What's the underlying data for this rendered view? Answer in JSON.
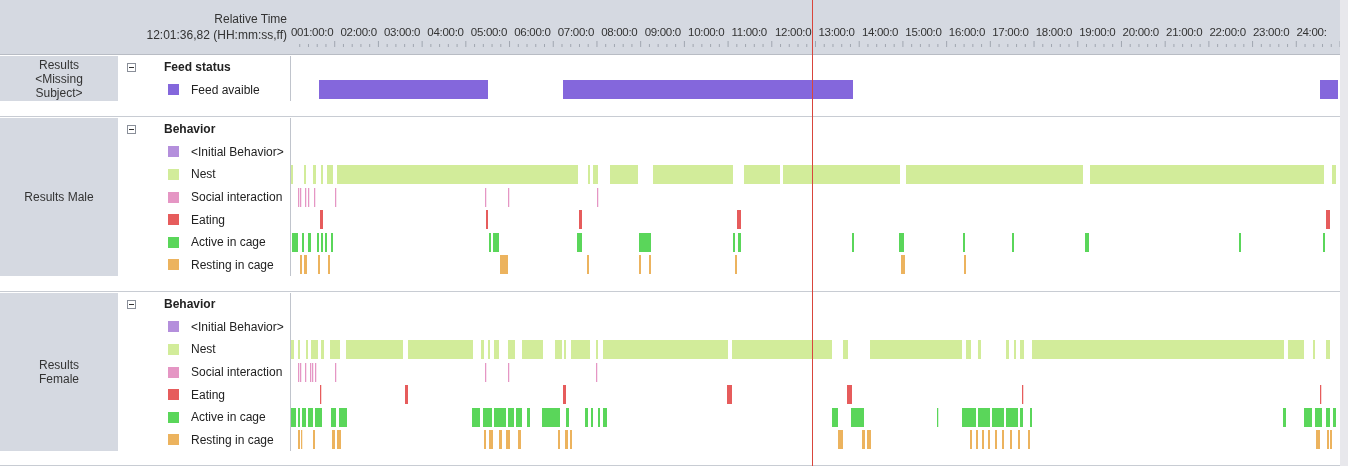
{
  "header": {
    "title": "Relative Time",
    "start": "12:01:36,82 (HH:mm:ss,ff)",
    "ticks": [
      "0",
      "01:00:0",
      "02:00:0",
      "03:00:0",
      "04:00:0",
      "05:00:0",
      "06:00:0",
      "07:00:0",
      "08:00:0",
      "09:00:0",
      "10:00:0",
      "11:00:0",
      "12:00:0",
      "13:00:0",
      "14:00:0",
      "15:00:0",
      "16:00:0",
      "17:00:0",
      "18:00:0",
      "19:00:0",
      "20:00:0",
      "21:00:0",
      "22:00:0",
      "23:00:0",
      "24:00:"
    ]
  },
  "sections": [
    {
      "subject": "Results <Missing Subject>",
      "group": {
        "title": "Feed status",
        "expanded": true,
        "items": [
          {
            "label": "Feed avaible",
            "color": "#8467dc"
          }
        ]
      }
    },
    {
      "subject": "Results Male",
      "group": {
        "title": "Behavior",
        "expanded": true,
        "items": [
          {
            "label": "<Initial Behavior>",
            "color": "#b48fdc"
          },
          {
            "label": "Nest",
            "color": "#d2ec9a"
          },
          {
            "label": "Social interaction",
            "color": "#e596c4"
          },
          {
            "label": "Eating",
            "color": "#e65c5c"
          },
          {
            "label": "Active in cage",
            "color": "#5ad65a"
          },
          {
            "label": "Resting in cage",
            "color": "#ecb35e"
          }
        ]
      }
    },
    {
      "subject": "Results Female",
      "group": {
        "title": "Behavior",
        "expanded": true,
        "items": [
          {
            "label": "<Initial Behavior>",
            "color": "#b48fdc"
          },
          {
            "label": "Nest",
            "color": "#d2ec9a"
          },
          {
            "label": "Social interaction",
            "color": "#e596c4"
          },
          {
            "label": "Eating",
            "color": "#e65c5c"
          },
          {
            "label": "Active in cage",
            "color": "#5ad65a"
          },
          {
            "label": "Resting in cage",
            "color": "#ecb35e"
          }
        ]
      }
    }
  ]
}
